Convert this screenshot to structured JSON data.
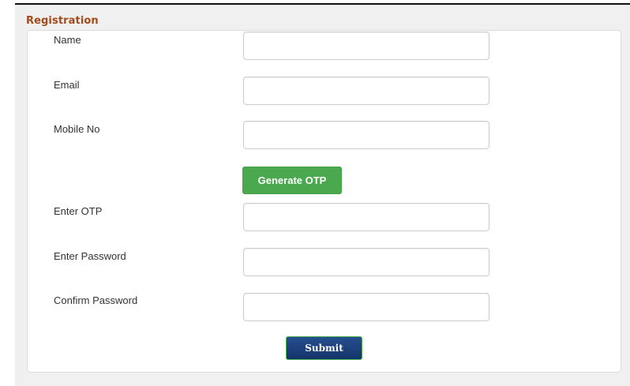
{
  "form": {
    "title": "Registration",
    "fields": [
      {
        "label": "Name",
        "value": ""
      },
      {
        "label": "Email",
        "value": ""
      },
      {
        "label": "Mobile No",
        "value": ""
      },
      {
        "label": "Enter OTP",
        "value": ""
      },
      {
        "label": "Enter Password",
        "value": ""
      },
      {
        "label": "Confirm Password",
        "value": ""
      }
    ],
    "generate_otp_label": "Generate OTP",
    "submit_label": "Submit"
  },
  "colors": {
    "title": "#a34a1b",
    "otp_button": "#4aa84f",
    "submit_button": "#1c3f7a",
    "background": "#f0f0f0"
  }
}
